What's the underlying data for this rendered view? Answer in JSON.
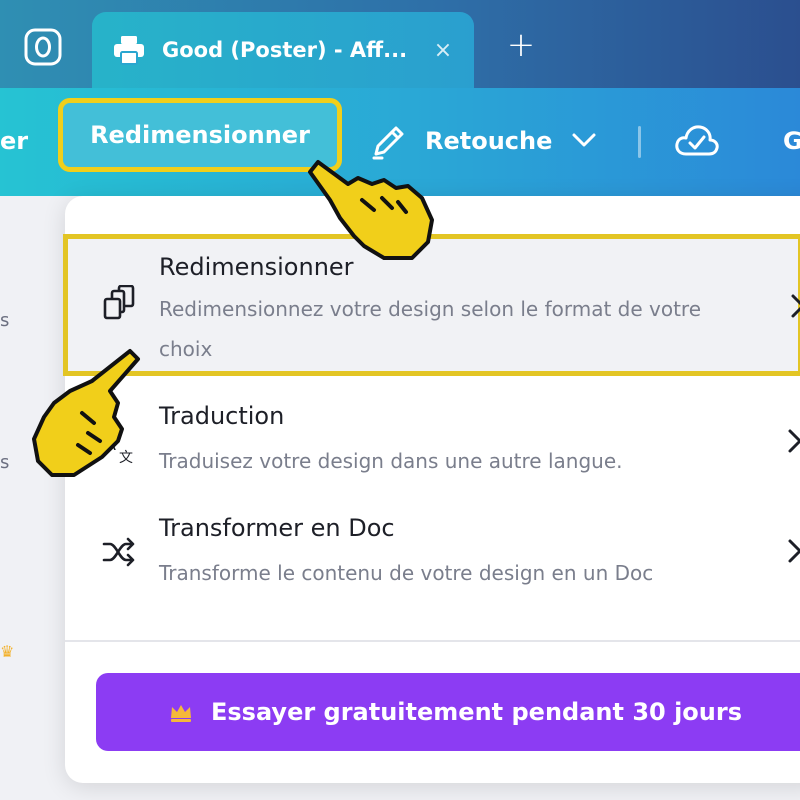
{
  "tabbar": {
    "home_icon": "home-icon",
    "active_tab": {
      "favicon": "printer-icon",
      "title": "Good (Poster) - Aff...",
      "close": "×"
    },
    "new_tab": "+"
  },
  "toolbar": {
    "prev_fragment": "er",
    "resize_label": "Redimensionner",
    "edit_icon": "pencil-icon",
    "retouche_label": "Retouche",
    "cloud_icon": "cloud-check-icon",
    "next_fragment": "G"
  },
  "sidebar": {
    "fragments": [
      "s",
      "s"
    ]
  },
  "dropdown": {
    "items": [
      {
        "icon": "resize-icon",
        "title": "Redimensionner",
        "description": "Redimensionnez votre design selon le format de votre choix"
      },
      {
        "icon": "translate-icon",
        "title": "Traduction",
        "description": "Traduisez votre design dans une autre langue."
      },
      {
        "icon": "shuffle-icon",
        "title": "Transformer en Doc",
        "description": "Transforme le contenu de votre design en un Doc"
      }
    ],
    "cta_label": "Essayer gratuitement pendant 30 jours"
  },
  "colors": {
    "highlight_border": "#f1cf1a",
    "cta_background": "#8c3cf3",
    "toolbar_start": "#26c3d3",
    "toolbar_end": "#2b89d8"
  }
}
